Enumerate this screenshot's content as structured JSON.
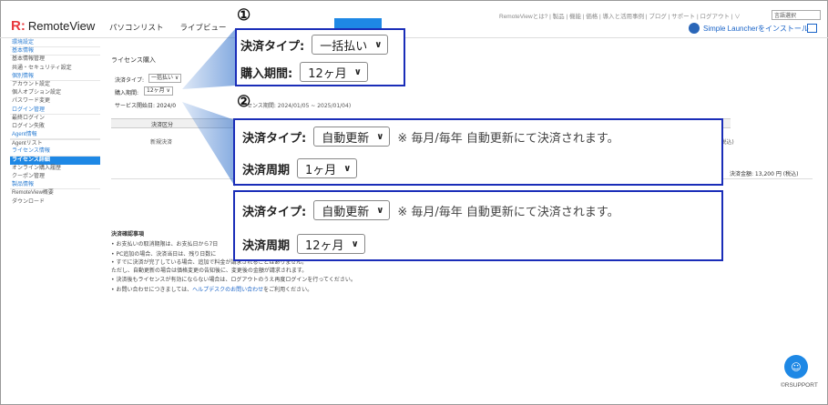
{
  "header": {
    "logo_mark": "R:",
    "logo_text": "RemoteView",
    "nav": [
      "パソコンリスト",
      "ライブビュー"
    ],
    "util_links": "RemoteViewとは? | 製品 | 機能 | 価格 | 導入と活用事例 | ブログ | サポート | ログアウト | ∨",
    "lang": "言語選択",
    "launcher": "Simple Launcherをインストール"
  },
  "sidebar": {
    "items": [
      {
        "label": "環境設定",
        "type": "head"
      },
      {
        "label": "基本情報",
        "type": "head"
      },
      {
        "label": "基本情報管理",
        "type": "sub"
      },
      {
        "label": "共通・セキュリティ設定",
        "type": "sub"
      },
      {
        "label": "個別情報",
        "type": "head"
      },
      {
        "label": "アカウント設定",
        "type": "sub"
      },
      {
        "label": "個人オプション設定",
        "type": "sub"
      },
      {
        "label": "パスワード変更",
        "type": "sub"
      },
      {
        "label": "ログイン管理",
        "type": "head"
      },
      {
        "label": "最終ログイン",
        "type": "sub"
      },
      {
        "label": "ログイン失敗",
        "type": "sub"
      },
      {
        "label": "Agent情報",
        "type": "head"
      },
      {
        "label": "Agentリスト",
        "type": "sep"
      },
      {
        "label": "ライセンス情報",
        "type": "head"
      },
      {
        "label": "ライセンス詳細",
        "type": "active"
      },
      {
        "label": "オンライン購入履歴",
        "type": "sub"
      },
      {
        "label": "クーポン管理",
        "type": "sub"
      },
      {
        "label": "製品情報",
        "type": "head"
      },
      {
        "label": "RemoteView概要",
        "type": "sub"
      },
      {
        "label": "ダウンロード",
        "type": "sub"
      }
    ]
  },
  "main": {
    "title": "ライセンス購入",
    "pay_type_label": "決済タイプ:",
    "pay_type_value": "一括払い",
    "period_label": "購入期間:",
    "period_value": "12ヶ月",
    "service_start_label": "サービス開始日:",
    "service_start_value": "2024/0",
    "license_period": "センス期間: 2024/01/05 ~ 2025/01/04)",
    "col_pay": "決済区分",
    "row_pay": "新規決済",
    "tax_note": "(税込)",
    "total": "決済金額: 13,200 円 (税込)",
    "notes_title": "決済確認事項",
    "notes": [
      "• お支払いの取消期限は、お支払日から7日",
      "• PC追加の場合、決済当日は、残り日数に",
      "• すでに決済が完了している場合、追加で料金が請求されることはありません。",
      "   ただし、自動更新の場合は価格変更の告知後に、変更後の金額が請求されます。",
      "• 決済後もライセンスが有効にならない場合は、ログアウトのうえ再度ログインを行ってください。"
    ],
    "contact_prefix": "• お問い合わせにつきましては、",
    "contact_link": "ヘルプデスクのお問い合わせ",
    "contact_suffix": "をご利用ください。"
  },
  "callouts": {
    "num1": "①",
    "num2": "②",
    "c1": {
      "pay_label": "決済タイプ:",
      "pay_value": "一括払い",
      "period_label": "購入期間:",
      "period_value": "12ヶ月"
    },
    "c2": {
      "pay_label": "決済タイプ:",
      "pay_value": "自動更新",
      "note": "※ 毎月/毎年 自動更新にて決済されます。",
      "cycle_label": "決済周期",
      "cycle_value": "1ヶ月"
    },
    "c3": {
      "pay_label": "決済タイプ:",
      "pay_value": "自動更新",
      "note": "※ 毎月/毎年 自動更新にて決済されます。",
      "cycle_label": "決済周期",
      "cycle_value": "12ヶ月"
    }
  },
  "footer": {
    "chat_icon": "☺",
    "copyright": "©RSUPPORT"
  },
  "colors": {
    "accent": "#1e88e5",
    "callout_border": "#1a2db8",
    "logo_red": "#e8383d"
  }
}
